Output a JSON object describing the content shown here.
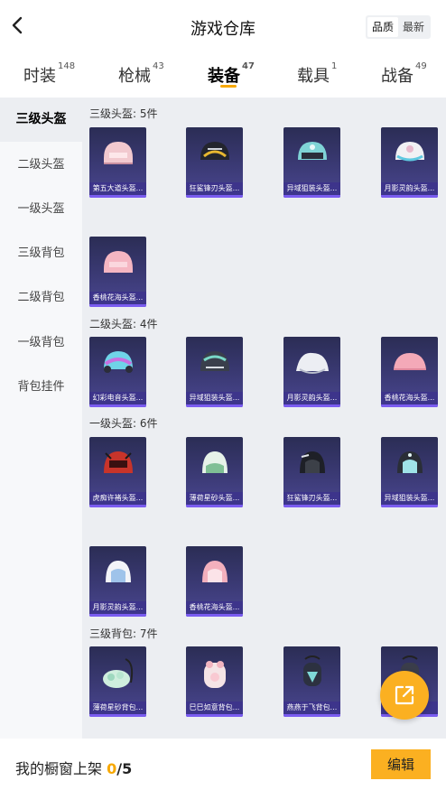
{
  "header": {
    "title": "游戏仓库",
    "sort_options": [
      "品质",
      "最新"
    ],
    "sort_active": "品质"
  },
  "tabs": [
    {
      "label": "时装",
      "count": "148"
    },
    {
      "label": "枪械",
      "count": "43"
    },
    {
      "label": "装备",
      "count": "47",
      "active": true
    },
    {
      "label": "载具",
      "count": "1"
    },
    {
      "label": "战备",
      "count": "49"
    }
  ],
  "sidebar": [
    {
      "label": "三级头盔",
      "active": true
    },
    {
      "label": "二级头盔"
    },
    {
      "label": "一级头盔"
    },
    {
      "label": "三级背包"
    },
    {
      "label": "二级背包"
    },
    {
      "label": "一级背包"
    },
    {
      "label": "背包挂件"
    }
  ],
  "sections": [
    {
      "title": "三级头盔: 5件",
      "items": [
        "第五大道头盔...",
        "狂鲨锋刃头盔...",
        "异域狙装头盔...",
        "月影灵韵头盔...",
        "香桃花海头盔..."
      ]
    },
    {
      "title": "二级头盔: 4件",
      "items": [
        "幻彩电音头盔...",
        "异域狙装头盔...",
        "月影灵韵头盔...",
        "香桃花海头盔..."
      ]
    },
    {
      "title": "一级头盔: 6件",
      "items": [
        "虎痴许褚头盔...",
        "薄荷星砂头盔...",
        "狂鲨锋刃头盔...",
        "异域狙装头盔...",
        "月影灵韵头盔...",
        "香桃花海头盔..."
      ]
    },
    {
      "title": "三级背包: 7件",
      "items": [
        "薄荷星砂背包...",
        "巳巳如意背包...",
        "燕燕于飞背包...",
        ""
      ]
    }
  ],
  "footer": {
    "shelf_label": "我的橱窗上架",
    "shelf_current": "0",
    "shelf_total": "/5",
    "edit_label": "编辑"
  },
  "colors": {
    "accent": "#fbb021",
    "card_bg": "#3b3a75",
    "card_stripe": "#7a5cf0"
  }
}
